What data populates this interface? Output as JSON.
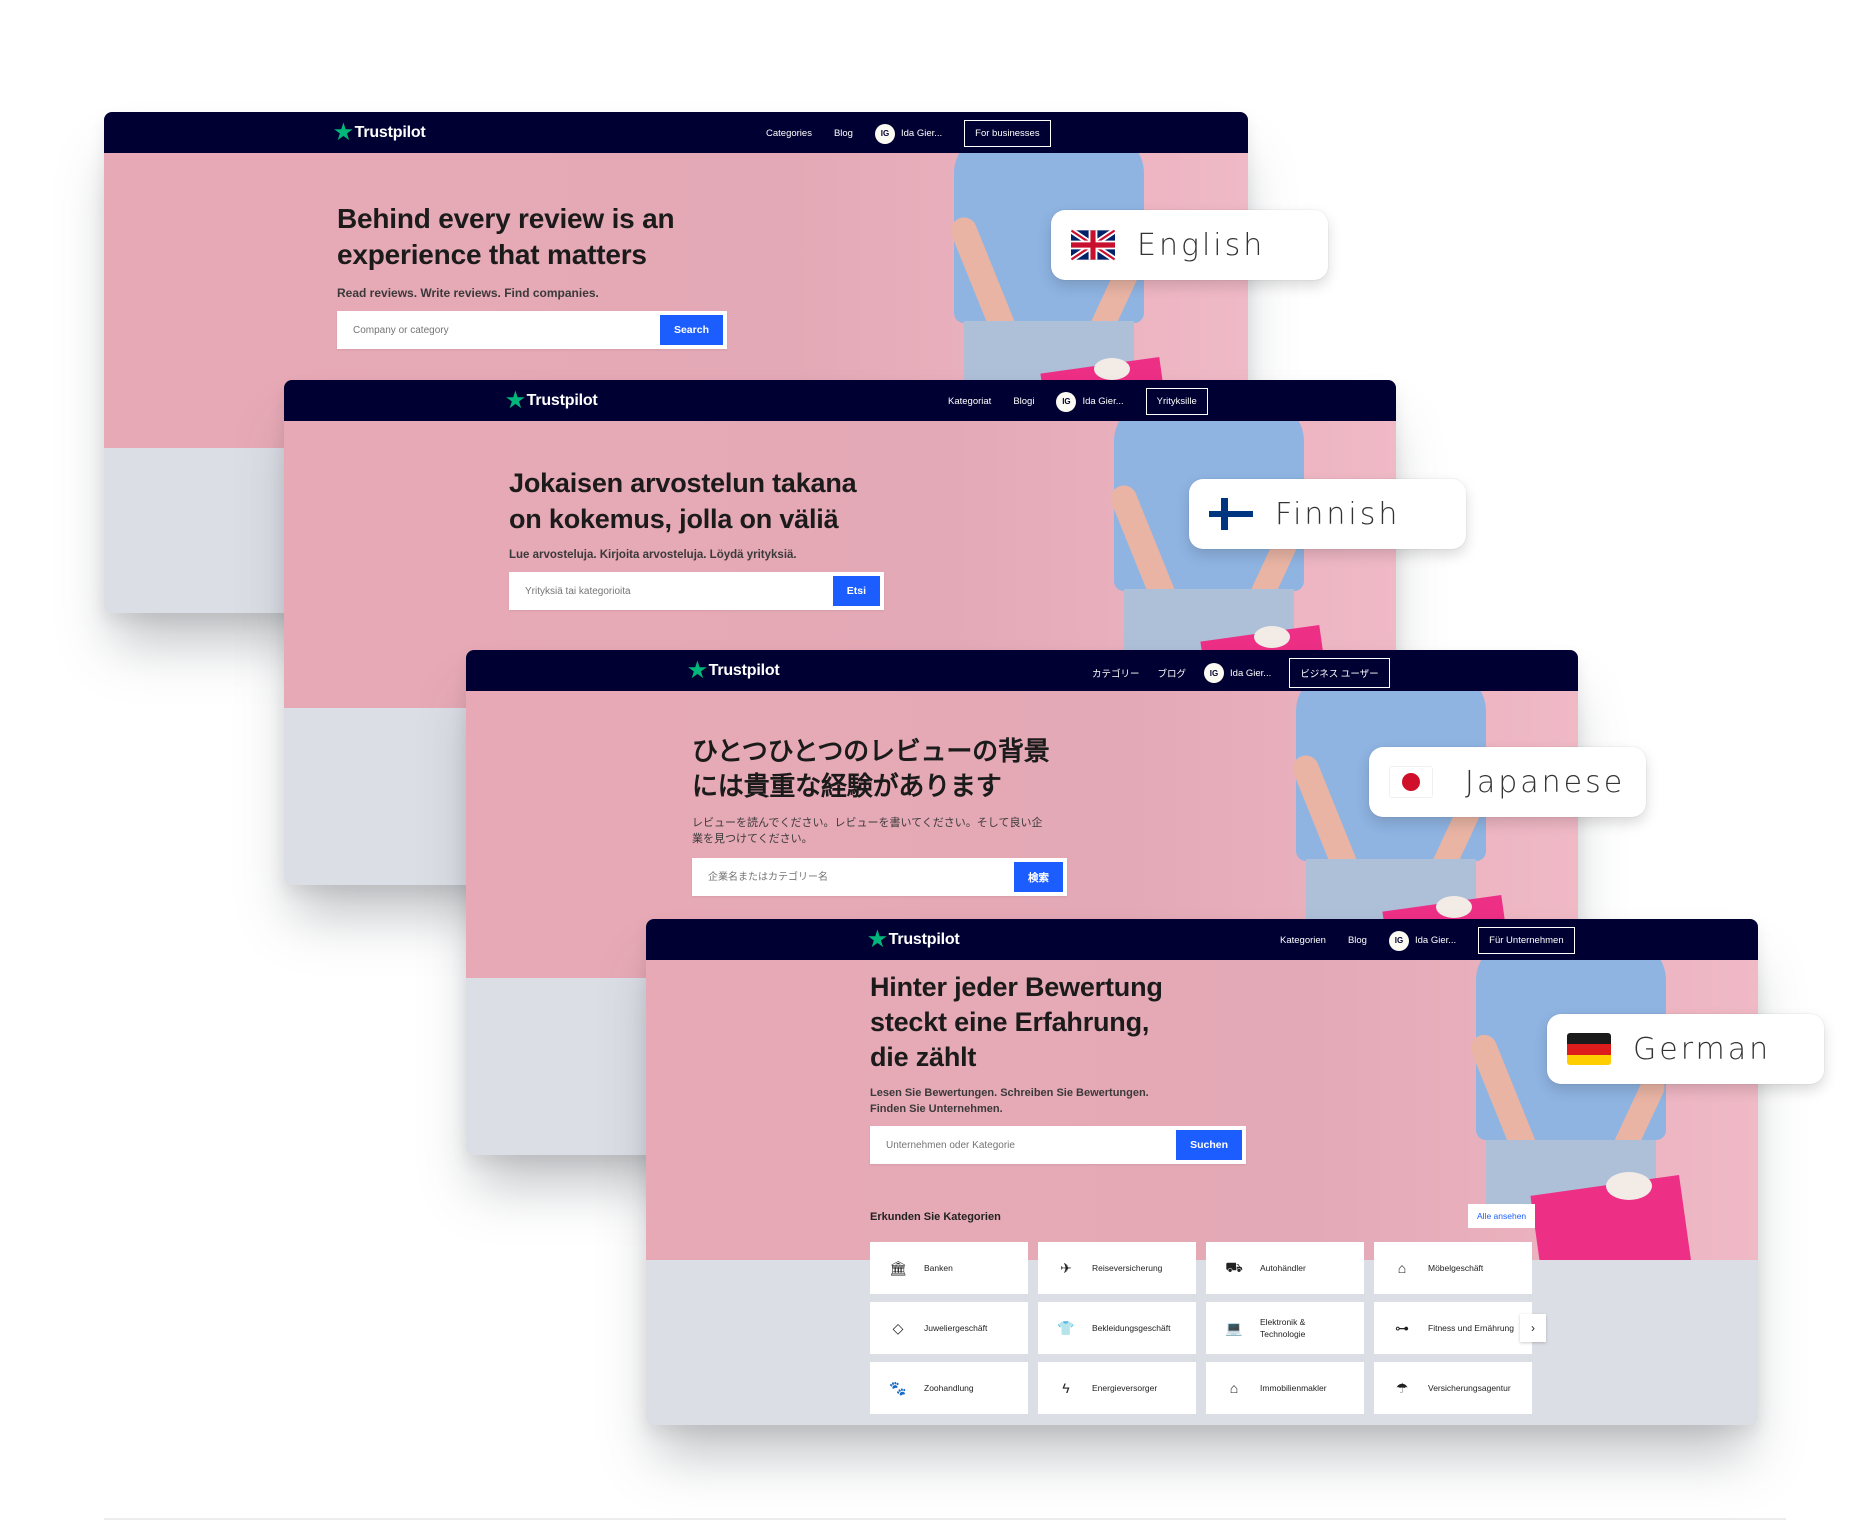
{
  "brand": {
    "name": "Trustpilot",
    "star_color": "#00b67a",
    "header_color": "#000032",
    "accent": "#1c5dff"
  },
  "cards": [
    {
      "id": "english",
      "nav": {
        "categories": "Categories",
        "blog": "Blog",
        "avatar_initials": "IG",
        "user_name": "Ida Gier...",
        "business_button": "For businesses"
      },
      "hero": {
        "title_line1": "Behind every review is an",
        "title_line2": "experience that matters",
        "subtitle": "Read reviews. Write reviews. Find companies.",
        "search_placeholder": "Company or category",
        "search_button": "Search"
      },
      "language_pill": {
        "label": "English",
        "flag": "uk-flag-icon"
      }
    },
    {
      "id": "finnish",
      "nav": {
        "categories": "Kategoriat",
        "blog": "Blogi",
        "avatar_initials": "IG",
        "user_name": "Ida Gier...",
        "business_button": "Yrityksille"
      },
      "hero": {
        "title_line1": "Jokaisen arvostelun takana",
        "title_line2": "on kokemus, jolla on väliä",
        "subtitle": "Lue arvosteluja. Kirjoita arvosteluja. Löydä yrityksiä.",
        "search_placeholder": "Yrityksiä tai kategorioita",
        "search_button": "Etsi"
      },
      "language_pill": {
        "label": "Finnish",
        "flag": "finland-flag-icon"
      }
    },
    {
      "id": "japanese",
      "nav": {
        "categories": "カテゴリー",
        "blog": "ブログ",
        "avatar_initials": "IG",
        "user_name": "Ida Gier...",
        "business_button": "ビジネス ユーザー"
      },
      "hero": {
        "title_line1": "ひとつひとつのレビューの背景",
        "title_line2": "には貴重な経験があります",
        "subtitle_line1": "レビューを読んでください。レビューを書いてください。そして良い企",
        "subtitle_line2": "業を見つけてください。",
        "search_placeholder": "企業名またはカテゴリー名",
        "search_button": "検索"
      },
      "language_pill": {
        "label": "Japanese",
        "flag": "japan-flag-icon"
      }
    },
    {
      "id": "german",
      "nav": {
        "categories": "Kategorien",
        "blog": "Blog",
        "avatar_initials": "IG",
        "user_name": "Ida Gier...",
        "business_button": "Für Unternehmen"
      },
      "hero": {
        "title_line1": "Hinter jeder Bewertung",
        "title_line2": "steckt eine Erfahrung,",
        "title_line3": "die zählt",
        "subtitle_line1": "Lesen Sie Bewertungen. Schreiben Sie Bewertungen.",
        "subtitle_line2": "Finden Sie Unternehmen.",
        "search_placeholder": "Unternehmen oder Kategorie",
        "search_button": "Suchen"
      },
      "categories": {
        "title": "Erkunden Sie Kategorien",
        "see_all": "Alle ansehen",
        "items": [
          {
            "label": "Banken",
            "icon": "bank-icon"
          },
          {
            "label": "Reiseversicherung",
            "icon": "airplane-icon"
          },
          {
            "label": "Autohändler",
            "icon": "car-icon"
          },
          {
            "label": "Möbelgeschäft",
            "icon": "armchair-icon"
          },
          {
            "label": "Juweliergeschäft",
            "icon": "diamond-icon"
          },
          {
            "label": "Bekleidungsgeschäft",
            "icon": "shirt-icon"
          },
          {
            "label": "Elektronik & Technologie",
            "icon": "laptop-icon"
          },
          {
            "label": "Fitness und Ernährung",
            "icon": "dumbbell-icon"
          },
          {
            "label": "Zoohandlung",
            "icon": "paw-icon"
          },
          {
            "label": "Energieversorger",
            "icon": "lightning-icon"
          },
          {
            "label": "Immobilienmakler",
            "icon": "house-icon"
          },
          {
            "label": "Versicherungsagentur",
            "icon": "umbrella-icon"
          }
        ]
      },
      "language_pill": {
        "label": "German",
        "flag": "germany-flag-icon"
      }
    }
  ]
}
